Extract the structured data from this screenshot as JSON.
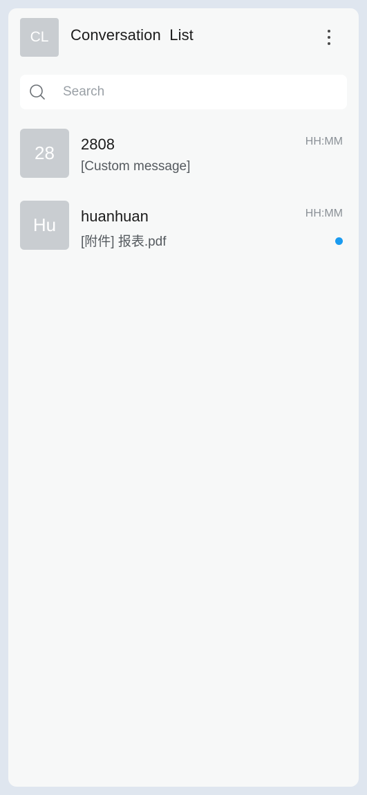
{
  "header": {
    "avatar_text": "CL",
    "title": "Conversation  List",
    "more_icon": "more-vertical-icon"
  },
  "search": {
    "placeholder": "Search",
    "value": "",
    "icon": "search-icon"
  },
  "conversations": [
    {
      "avatar_text": "28",
      "name": "2808",
      "preview": "[Custom message]",
      "time": "HH:MM",
      "unread": false
    },
    {
      "avatar_text": "Hu",
      "name": "huanhuan",
      "preview": "[附件] 报表.pdf",
      "time": "HH:MM",
      "unread": true
    }
  ],
  "colors": {
    "frame": "#dfe6ef",
    "panel": "#f7f8f8",
    "avatar_bg": "#c9cdd1",
    "unread_dot": "#1a9bf0"
  }
}
